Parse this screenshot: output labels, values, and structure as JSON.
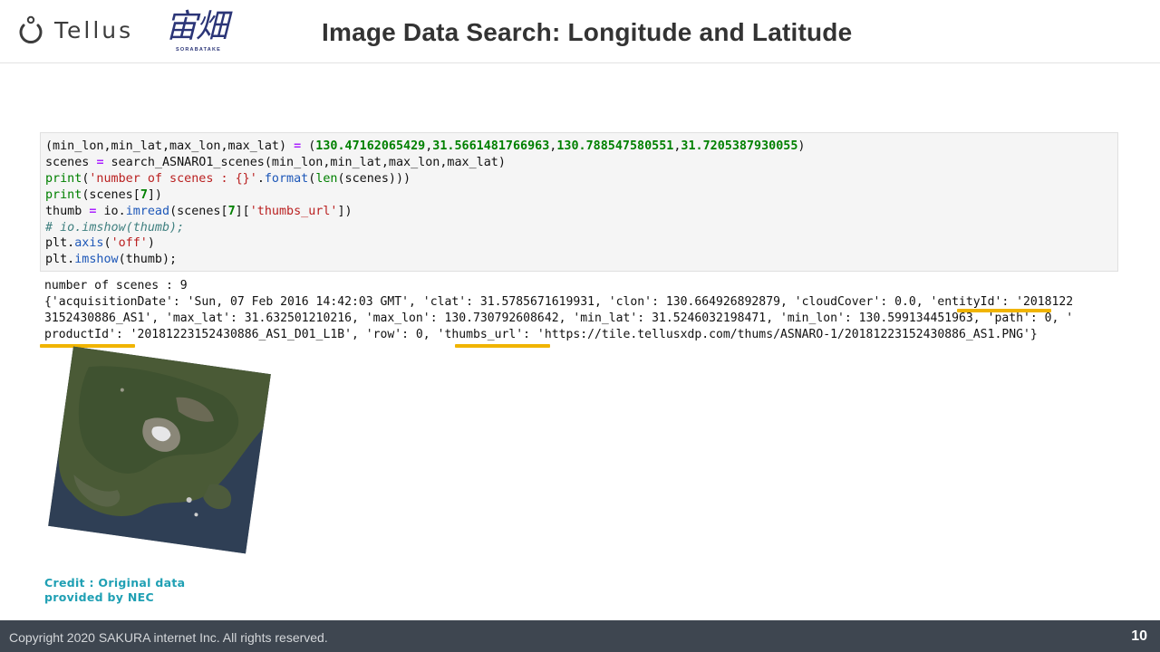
{
  "header": {
    "logo_text": "Tellus",
    "sub_logo_kanji": "宙畑",
    "sub_logo_text": "SORABATAKE",
    "title": "Image Data Search: Longitude and Latitude"
  },
  "code_cell": {
    "line1": {
      "lhs": "(min_lon,min_lat,max_lon,max_lat) ",
      "eq": "=",
      "open": " (",
      "n1": "130.47162065429",
      "n2": "31.5661481766963",
      "n3": "130.788547580551",
      "n4": "31.7205387930055",
      "comma": ",",
      "close": ")"
    },
    "line2": {
      "lhs": "scenes ",
      "eq": "=",
      "rest": " search_ASNARO1_scenes(min_lon,min_lat,max_lon,max_lat)"
    },
    "line3": {
      "print": "print",
      "open": "(",
      "str": "'number of scenes : {}'",
      "dot": ".",
      "format": "format",
      "open2": "(",
      "len": "len",
      "rest": "(scenes)))"
    },
    "line4": {
      "print": "print",
      "rest": "(scenes[",
      "num": "7",
      "close": "])"
    },
    "line5": {
      "lhs": "thumb ",
      "eq": "=",
      "mid": " io.",
      "imread": "imread",
      "mid2": "(scenes[",
      "num": "7",
      "mid3": "][",
      "str": "'thumbs_url'",
      "close": "])"
    },
    "line6": "# io.imshow(thumb);",
    "line7": {
      "pre": "plt.",
      "axis": "axis",
      "open": "(",
      "str": "'off'",
      "close": ")"
    },
    "line8": {
      "pre": "plt.",
      "imshow": "imshow",
      "close": "(thumb);"
    }
  },
  "output": {
    "line1": "number of scenes : 9",
    "line2": "{'acquisitionDate': 'Sun, 07 Feb 2016 14:42:03 GMT', 'clat': 31.5785671619931, 'clon': 130.664926892879, 'cloudCover': 0.0, 'entityId': '2018122",
    "line3": "3152430886_AS1', 'max_lat': 31.632501210216, 'max_lon': 130.730792608642, 'min_lat': 31.5246032198471, 'min_lon': 130.599134451963, 'path': 0, '",
    "line4": "productId': '20181223152430886_AS1_D01_L1B', 'row': 0, 'thumbs_url': 'https://tile.tellusxdp.com/thums/ASNARO-1/20181223152430886_AS1.PNG'}"
  },
  "credit": {
    "line1": "Credit : Original data",
    "line2": "provided by NEC"
  },
  "footer": {
    "copyright": "Copyright 2020 SAKURA  internet Inc.  All rights reserved.",
    "page_number": "10"
  },
  "colors": {
    "highlight": "#f0b400",
    "footer_bg": "#3e4650",
    "credit": "#20a0b4",
    "sub_logo": "#2b3577"
  }
}
